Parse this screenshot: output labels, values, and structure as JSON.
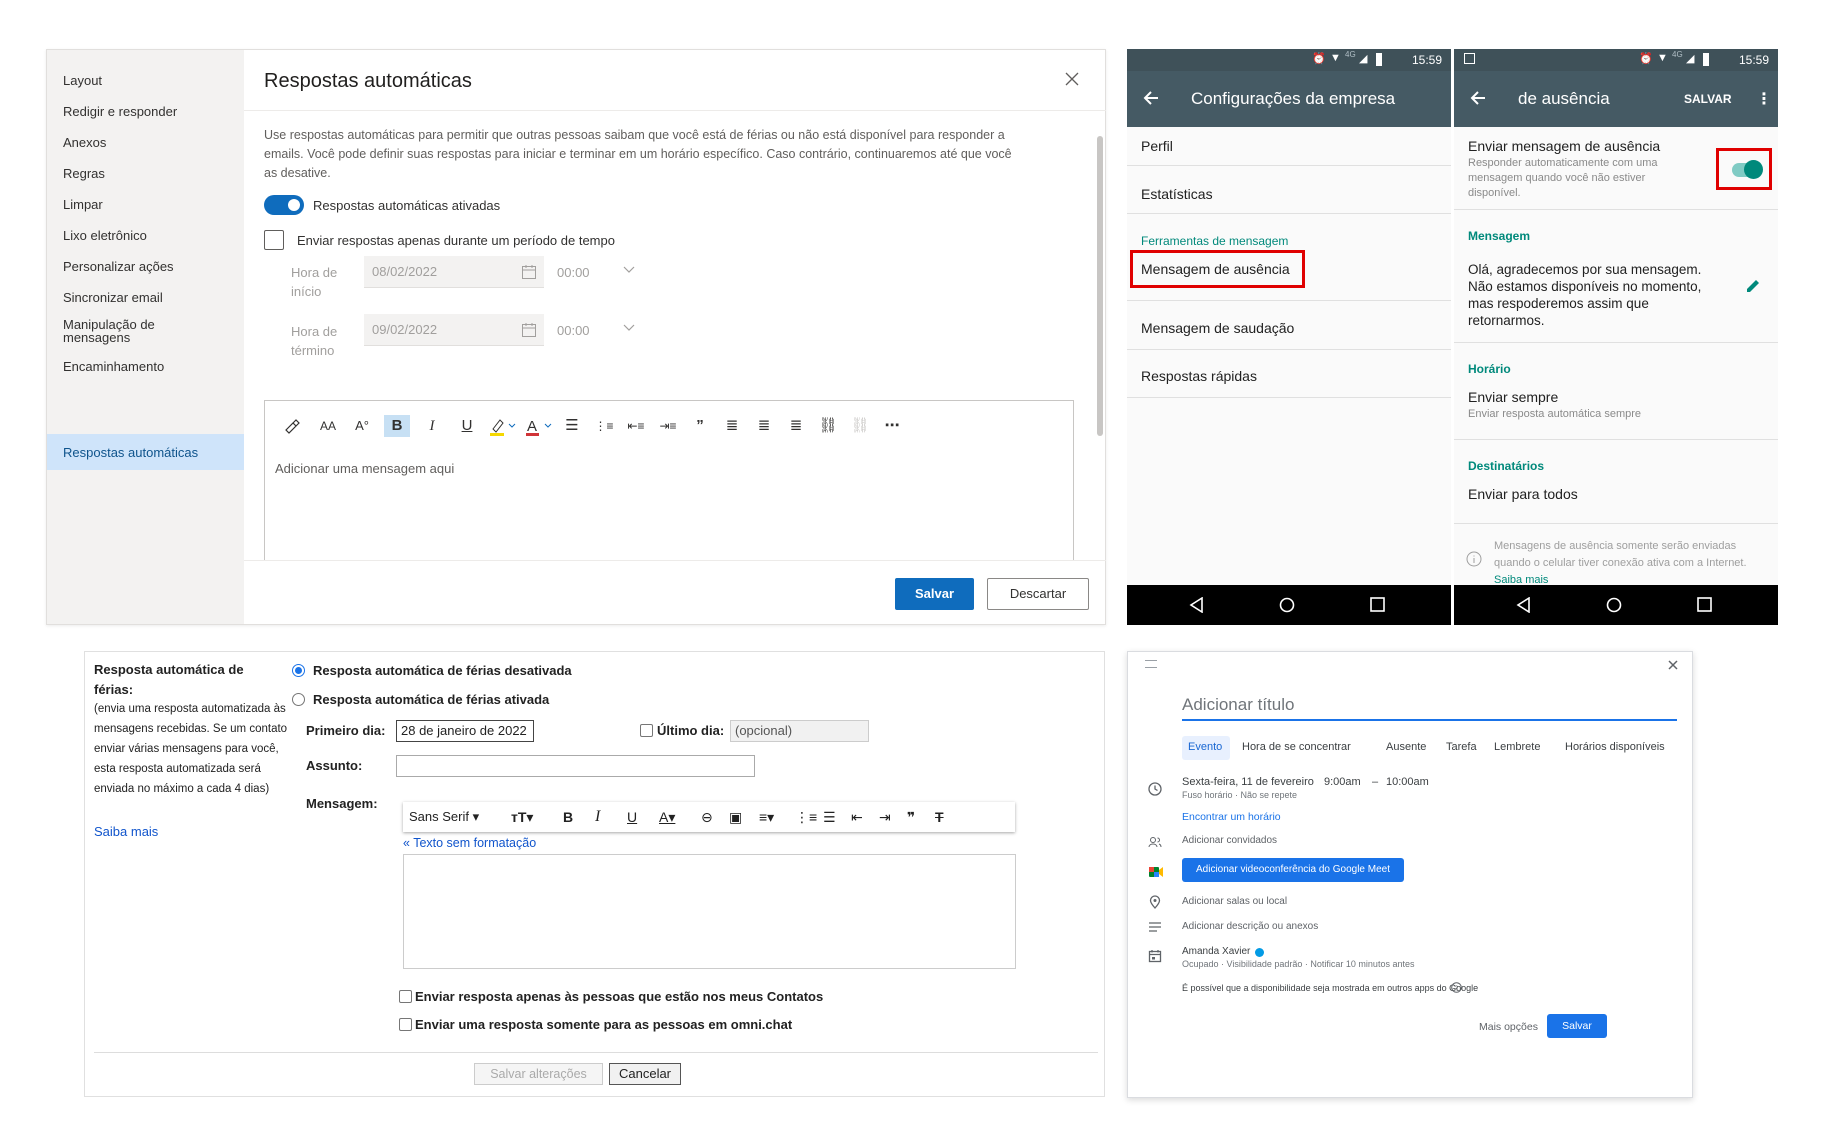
{
  "outlook": {
    "sidebar": [
      "Layout",
      "Redigir e responder",
      "Anexos",
      "Regras",
      "Limpar",
      "Lixo eletrônico",
      "Personalizar ações",
      "Sincronizar email",
      "Manipulação de mensagens",
      "Encaminhamento",
      "Respostas automáticas"
    ],
    "title": "Respostas automáticas",
    "description": "Use respostas automáticas para permitir que outras pessoas saibam que você está de férias ou não está disponível para responder a emails. Você pode definir suas respostas para iniciar e terminar em um horário específico. Caso contrário, continuaremos até que você as desative.",
    "toggle_label": "Respostas automáticas ativadas",
    "toggle_on": true,
    "period_label": "Enviar respostas apenas durante um período de tempo",
    "start_label": "Hora de início",
    "start_date": "08/02/2022",
    "start_time": "00:00",
    "end_label": "Hora de término",
    "end_date": "09/02/2022",
    "end_time": "00:00",
    "editor_placeholder": "Adicionar uma mensagem aqui",
    "save": "Salvar",
    "discard": "Descartar",
    "accent": "#0f6cbd"
  },
  "phone1": {
    "time": "15:59",
    "network": "4G",
    "title": "Configurações da empresa",
    "items": [
      "Perfil",
      "Estatísticas"
    ],
    "section": "Ferramentas de mensagem",
    "tools": [
      "Mensagem de ausência",
      "Mensagem de saudação",
      "Respostas rápidas"
    ],
    "accent": "#455a64"
  },
  "phone2": {
    "time": "15:59",
    "network": "4G",
    "title": "de ausência",
    "save": "SALVAR",
    "away_title": "Enviar mensagem de ausência",
    "away_sub": "Responder automaticamente com uma mensagem quando você não estiver disponível.",
    "away_on": true,
    "msg_section": "Mensagem",
    "message": "Olá, agradecemos por sua mensagem. Não estamos disponíveis no momento, mas respoderemos assim que retornarmos.",
    "schedule_section": "Horário",
    "schedule_title": "Enviar sempre",
    "schedule_sub": "Enviar resposta automática sempre",
    "recipients_section": "Destinatários",
    "recipients_title": "Enviar para todos",
    "note": "Mensagens de ausência somente serão enviadas quando o celular tiver conexão ativa com a Internet.",
    "note_link": "Saiba mais",
    "accent": "#00897b"
  },
  "gmail": {
    "heading": "Resposta automática de férias:",
    "help": "(envia uma resposta automatizada às mensagens recebidas. Se um contato enviar várias mensagens para você, esta resposta automatizada será enviada no máximo a cada 4 dias)",
    "learn_more": "Saiba mais",
    "off_label": "Resposta automática de férias desativada",
    "on_label": "Resposta automática de férias ativada",
    "first_day_label": "Primeiro dia:",
    "first_day": "28 de janeiro de 2022",
    "last_day_label": "Último dia:",
    "last_day_placeholder": "(opcional)",
    "subject_label": "Assunto:",
    "message_label": "Mensagem:",
    "font": "Sans Serif",
    "plain_text": "« Texto sem formatação",
    "contacts_only": "Enviar resposta apenas às pessoas que estão nos meus Contatos",
    "domain_only": "Enviar uma resposta somente para as pessoas em omni.chat",
    "save": "Salvar alterações",
    "cancel": "Cancelar"
  },
  "calendar": {
    "title_placeholder": "Adicionar título",
    "tabs": [
      "Evento",
      "Hora de se concentrar",
      "Ausente",
      "Tarefa",
      "Lembrete",
      "Horários disponíveis"
    ],
    "date": "Sexta-feira, 11 de fevereiro",
    "start": "9:00am",
    "end": "10:00am",
    "timezone": "Fuso horário · Não se repete",
    "find_time": "Encontrar um horário",
    "guests": "Adicionar convidados",
    "meet": "Adicionar videoconferência do Google Meet",
    "room": "Adicionar salas ou local",
    "description": "Adicionar descrição ou anexos",
    "owner": "Amanda Xavier",
    "owner_sub": "Ocupado · Visibilidade padrão · Notificar 10 minutos antes",
    "availability": "É possível que a disponibilidade seja mostrada em outros apps do Google",
    "more": "Mais opções",
    "save": "Salvar",
    "accent": "#1a73e8"
  }
}
